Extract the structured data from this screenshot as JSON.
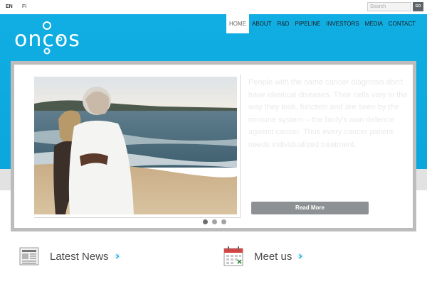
{
  "languages": [
    "EN",
    "FI"
  ],
  "search": {
    "placeholder": "Search",
    "button_label": "GO"
  },
  "logo": {
    "text": "oncos"
  },
  "nav": {
    "items": [
      {
        "label": "HOME",
        "active": true
      },
      {
        "label": "ABOUT",
        "active": false
      },
      {
        "label": "R&D",
        "active": false
      },
      {
        "label": "PIPELINE",
        "active": false
      },
      {
        "label": "INVESTORS",
        "active": false
      },
      {
        "label": "MEDIA",
        "active": false
      },
      {
        "label": "CONTACT",
        "active": false
      }
    ]
  },
  "slider": {
    "text": "People with the same cancer diagnosis don't have identical diseases. Their cells vary in the way they look, function and are seen by the immune system – the body's own defence against cancer. Thus every cancer patient needs individualized treatment.",
    "button_label": "Read More",
    "slide_count": 3,
    "active_slide": 1
  },
  "sections": {
    "news": {
      "title": "Latest News",
      "icon": "newspaper-icon"
    },
    "meet": {
      "title": "Meet us",
      "icon": "calendar-icon"
    }
  },
  "colors": {
    "header_blue": "#10aee3",
    "button_grey": "#8e9193",
    "nav_active_bg": "#ffffff"
  }
}
